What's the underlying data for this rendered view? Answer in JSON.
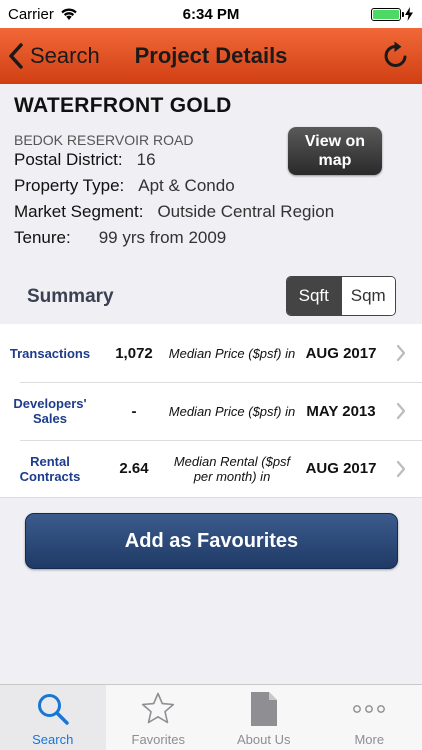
{
  "status": {
    "carrier": "Carrier",
    "time": "6:34 PM"
  },
  "nav": {
    "back_label": "Search",
    "title": "Project Details"
  },
  "project": {
    "name": "WATERFRONT GOLD",
    "address": "BEDOK RESERVOIR ROAD",
    "fields": [
      {
        "label": "Postal District:",
        "value": "16"
      },
      {
        "label": "Property Type:",
        "value": "Apt & Condo"
      },
      {
        "label": "Market Segment:",
        "value": "Outside Central Region"
      },
      {
        "label": "Tenure:",
        "value": "99 yrs from 2009"
      }
    ],
    "view_map_label": "View on map"
  },
  "summary": {
    "title": "Summary",
    "units": {
      "options": [
        "Sqft",
        "Sqm"
      ],
      "selected": "Sqft"
    },
    "rows": [
      {
        "type": "Transactions",
        "value": "1,072",
        "desc": "Median Price ($psf) in",
        "date": "AUG 2017"
      },
      {
        "type": "Developers' Sales",
        "value": "-",
        "desc": "Median Price ($psf) in",
        "date": "MAY 2013"
      },
      {
        "type": "Rental Contracts",
        "value": "2.64",
        "desc": "Median Rental ($psf per month) in",
        "date": "AUG 2017"
      }
    ]
  },
  "favourite_label": "Add as Favourites",
  "tabs": [
    {
      "label": "Search",
      "icon": "search-icon",
      "active": true
    },
    {
      "label": "Favorites",
      "icon": "star-icon",
      "active": false
    },
    {
      "label": "About Us",
      "icon": "document-icon",
      "active": false
    },
    {
      "label": "More",
      "icon": "more-icon",
      "active": false
    }
  ],
  "colors": {
    "nav": "#e4522a",
    "accent": "#1877d4",
    "button": "#2c4a7a"
  }
}
